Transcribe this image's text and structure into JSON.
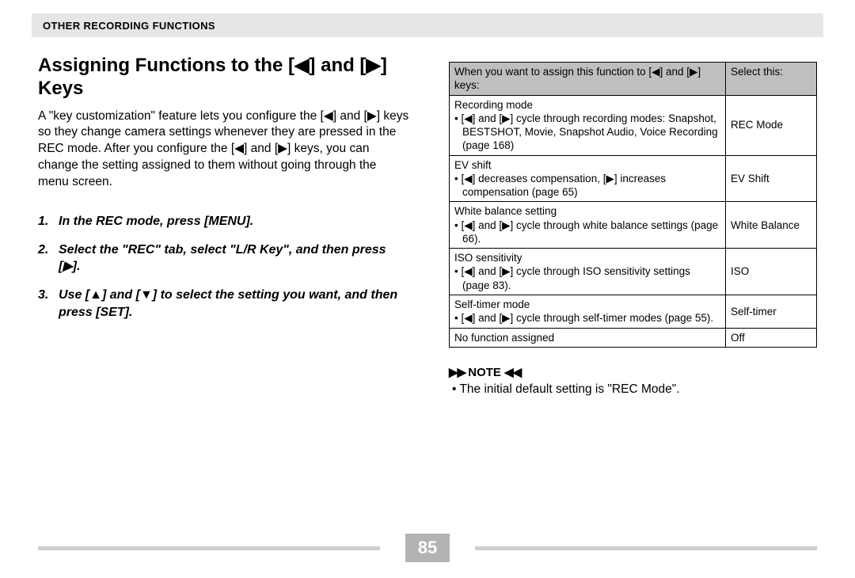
{
  "header": {
    "section": "Other Recording Functions"
  },
  "title_a": "Assigning Functions to the [◀] and [▶]",
  "title_b": "Keys",
  "intro": "A \"key customization\" feature lets you configure the [◀] and [▶] keys so they change camera settings whenever they are pressed in the REC mode. After you configure the [◀] and [▶] keys, you can change the setting assigned to them without going through the menu screen.",
  "steps": [
    "In the REC mode, press [MENU].",
    "Select the \"REC\" tab, select \"L/R Key\", and then press [▶].",
    "Use [▲] and [▼] to select the setting you want, and then press [SET]."
  ],
  "table": {
    "head_left": "When you want to assign this function to [◀] and [▶] keys:",
    "head_right": "Select this:",
    "rows": [
      {
        "heading": "Recording mode",
        "bullet": "• [◀] and [▶] cycle through recording modes: Snapshot, BESTSHOT, Movie, Snapshot Audio, Voice Recording (page 168)",
        "select": "REC Mode"
      },
      {
        "heading": "EV shift",
        "bullet": "• [◀] decreases compensation, [▶] increases compensation (page 65)",
        "select": "EV Shift"
      },
      {
        "heading": "White balance setting",
        "bullet": "• [◀] and [▶] cycle through white balance settings (page 66).",
        "select": "White Balance"
      },
      {
        "heading": "ISO sensitivity",
        "bullet": "• [◀] and [▶] cycle through ISO sensitivity settings (page 83).",
        "select": "ISO"
      },
      {
        "heading": "Self-timer mode",
        "bullet": "• [◀] and [▶] cycle through self-timer modes (page 55).",
        "select": "Self-timer"
      },
      {
        "heading": "No function assigned",
        "bullet": "",
        "select": "Off"
      }
    ]
  },
  "note": {
    "label": "NOTE",
    "text": "• The initial default setting is \"REC Mode\"."
  },
  "page": "85"
}
